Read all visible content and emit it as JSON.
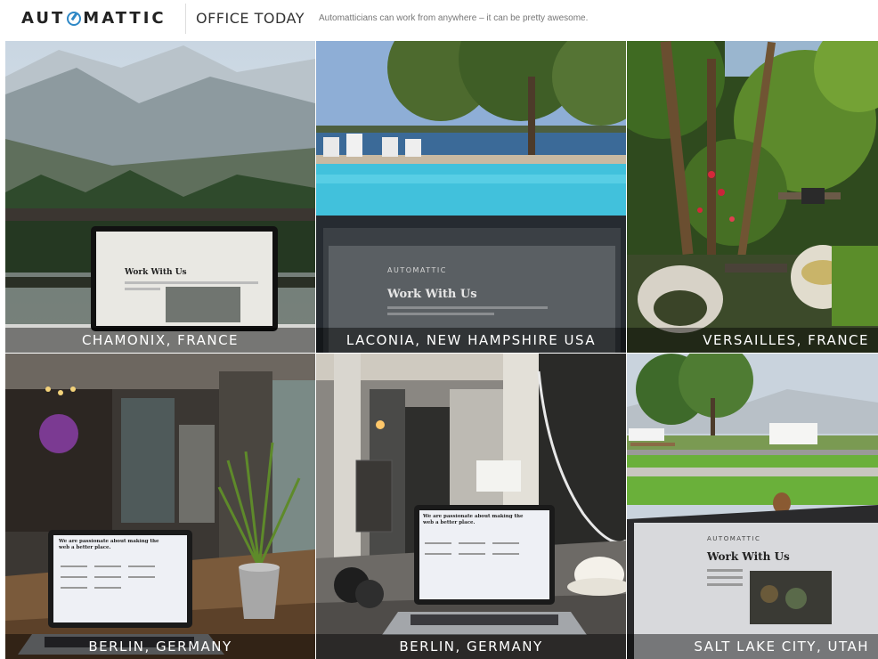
{
  "header": {
    "brand_letters_left": "AUT",
    "brand_letters_right": "MATTIC",
    "section_title": "OFFICE TODAY",
    "tagline": "Automatticians can work from anywhere – it can be pretty awesome."
  },
  "tiles": [
    {
      "caption": "CHAMONIX, FRANCE",
      "screen_title": "Work With Us"
    },
    {
      "caption": "LACONIA, NEW HAMPSHIRE USA",
      "screen_brand": "AUTOMATTIC",
      "screen_title": "Work With Us"
    },
    {
      "caption": "VERSAILLES, FRANCE"
    },
    {
      "caption": "BERLIN, GERMANY",
      "screen_title": "We are passionate about making the web a better place."
    },
    {
      "caption": "BERLIN, GERMANY",
      "screen_title": "We are passionate about making the web a better place."
    },
    {
      "caption": "SALT LAKE CITY, UTAH",
      "screen_brand": "AUTOMATTIC",
      "screen_title": "Work With Us"
    }
  ]
}
